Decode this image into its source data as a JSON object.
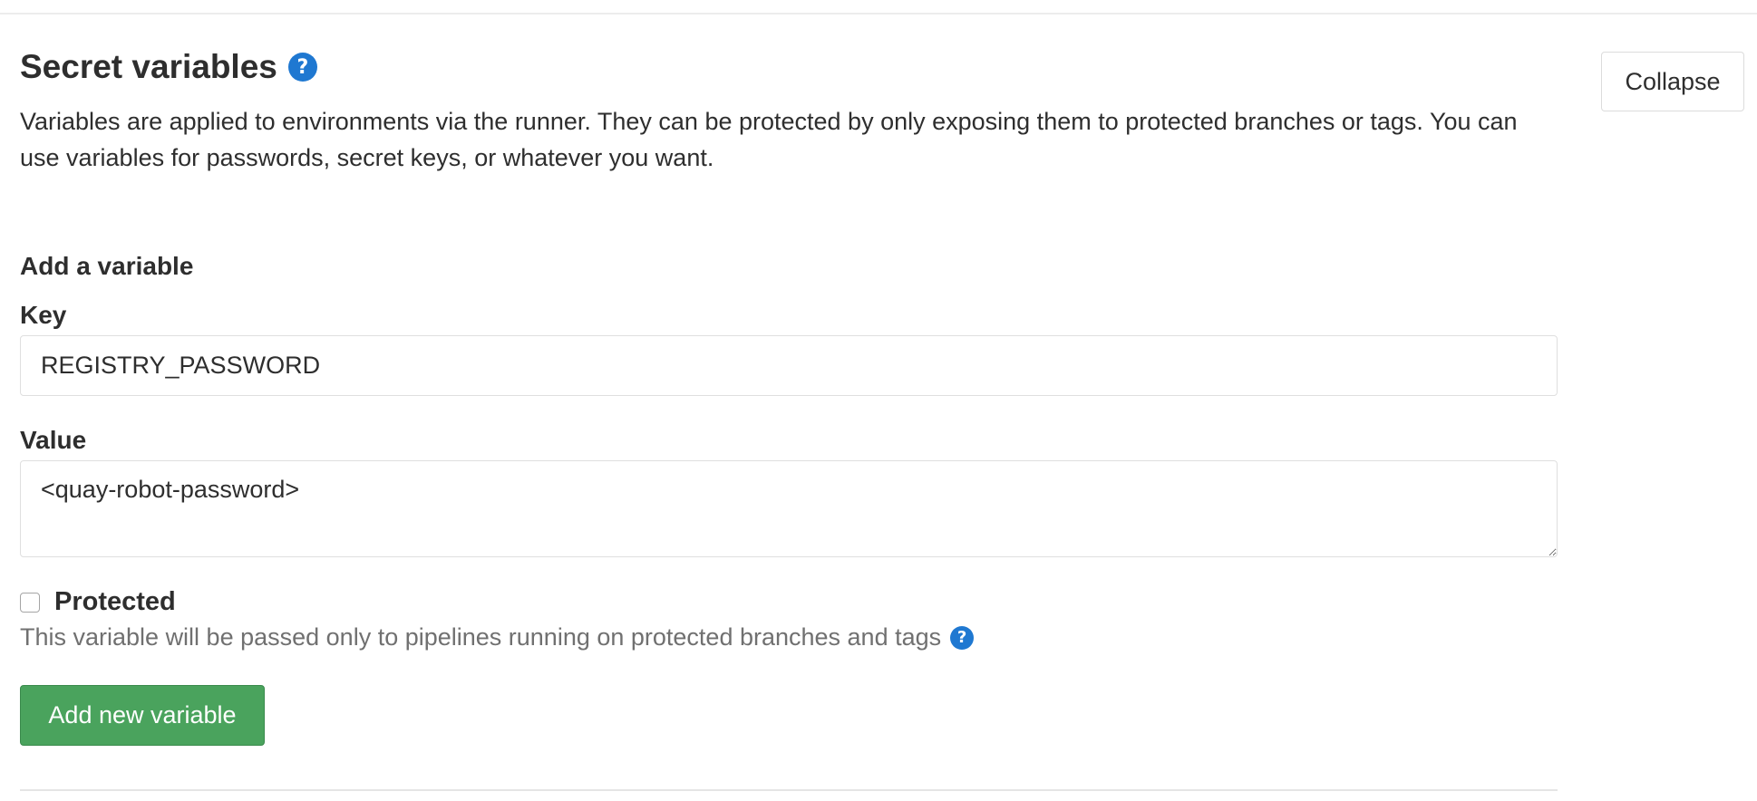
{
  "section": {
    "title": "Secret variables",
    "help_icon": "question-circle-icon",
    "collapse_label": "Collapse",
    "description": "Variables are applied to environments via the runner. They can be protected by only exposing them to protected branches or tags. You can use variables for passwords, secret keys, or whatever you want."
  },
  "form": {
    "heading": "Add a variable",
    "key_label": "Key",
    "key_value": "REGISTRY_PASSWORD",
    "value_label": "Value",
    "value_value": "<quay-robot-password>",
    "protected_label": "Protected",
    "protected_checked": false,
    "protected_help": "This variable will be passed only to pipelines running on protected branches and tags",
    "submit_label": "Add new variable"
  },
  "colors": {
    "accent_blue": "#1f78d1",
    "submit_green": "#4aa35d"
  }
}
